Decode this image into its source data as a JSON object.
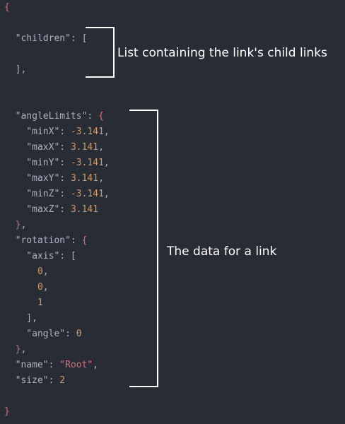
{
  "code": {
    "lines": [
      [
        {
          "t": "{",
          "c": "brace"
        }
      ],
      [],
      [
        {
          "t": "  \"children\"",
          "c": "key"
        },
        {
          "t": ": [",
          "c": "punct"
        }
      ],
      [],
      [
        {
          "t": "  ],",
          "c": "punct"
        }
      ],
      [],
      [],
      [
        {
          "t": "  \"angleLimits\"",
          "c": "key"
        },
        {
          "t": ": ",
          "c": "punct"
        },
        {
          "t": "{",
          "c": "brace"
        }
      ],
      [
        {
          "t": "    \"minX\"",
          "c": "key"
        },
        {
          "t": ": ",
          "c": "punct"
        },
        {
          "t": "-3.141",
          "c": "num"
        },
        {
          "t": ",",
          "c": "punct"
        }
      ],
      [
        {
          "t": "    \"maxX\"",
          "c": "key"
        },
        {
          "t": ": ",
          "c": "punct"
        },
        {
          "t": "3.141",
          "c": "num"
        },
        {
          "t": ",",
          "c": "punct"
        }
      ],
      [
        {
          "t": "    \"minY\"",
          "c": "key"
        },
        {
          "t": ": ",
          "c": "punct"
        },
        {
          "t": "-3.141",
          "c": "num"
        },
        {
          "t": ",",
          "c": "punct"
        }
      ],
      [
        {
          "t": "    \"maxY\"",
          "c": "key"
        },
        {
          "t": ": ",
          "c": "punct"
        },
        {
          "t": "3.141",
          "c": "num"
        },
        {
          "t": ",",
          "c": "punct"
        }
      ],
      [
        {
          "t": "    \"minZ\"",
          "c": "key"
        },
        {
          "t": ": ",
          "c": "punct"
        },
        {
          "t": "-3.141",
          "c": "num"
        },
        {
          "t": ",",
          "c": "punct"
        }
      ],
      [
        {
          "t": "    \"maxZ\"",
          "c": "key"
        },
        {
          "t": ": ",
          "c": "punct"
        },
        {
          "t": "3.141",
          "c": "num"
        }
      ],
      [
        {
          "t": "  ",
          "c": "punct"
        },
        {
          "t": "}",
          "c": "brace"
        },
        {
          "t": ",",
          "c": "punct"
        }
      ],
      [
        {
          "t": "  \"rotation\"",
          "c": "key"
        },
        {
          "t": ": ",
          "c": "punct"
        },
        {
          "t": "{",
          "c": "brace"
        }
      ],
      [
        {
          "t": "    \"axis\"",
          "c": "key"
        },
        {
          "t": ": [",
          "c": "punct"
        }
      ],
      [
        {
          "t": "      0",
          "c": "num"
        },
        {
          "t": ",",
          "c": "punct"
        }
      ],
      [
        {
          "t": "      0",
          "c": "num"
        },
        {
          "t": ",",
          "c": "punct"
        }
      ],
      [
        {
          "t": "      1",
          "c": "num"
        }
      ],
      [
        {
          "t": "    ],",
          "c": "punct"
        }
      ],
      [
        {
          "t": "    \"angle\"",
          "c": "key"
        },
        {
          "t": ": ",
          "c": "punct"
        },
        {
          "t": "0",
          "c": "num"
        }
      ],
      [
        {
          "t": "  ",
          "c": "punct"
        },
        {
          "t": "}",
          "c": "brace"
        },
        {
          "t": ",",
          "c": "punct"
        }
      ],
      [
        {
          "t": "  \"name\"",
          "c": "key"
        },
        {
          "t": ": ",
          "c": "punct"
        },
        {
          "t": "\"Root\"",
          "c": "str"
        },
        {
          "t": ",",
          "c": "punct"
        }
      ],
      [
        {
          "t": "  \"size\"",
          "c": "key"
        },
        {
          "t": ": ",
          "c": "punct"
        },
        {
          "t": "2",
          "c": "num"
        }
      ],
      [],
      [
        {
          "t": "}",
          "c": "brace"
        }
      ]
    ]
  },
  "annotations": {
    "children_note": "List containing the link's child links",
    "link_note": "The data for a link"
  },
  "colors": {
    "background": "#282c34",
    "key": "#abb2bf",
    "number": "#d19a66",
    "string": "#e06c75",
    "brace": "#e06c75",
    "annotation": "#ffffff"
  }
}
